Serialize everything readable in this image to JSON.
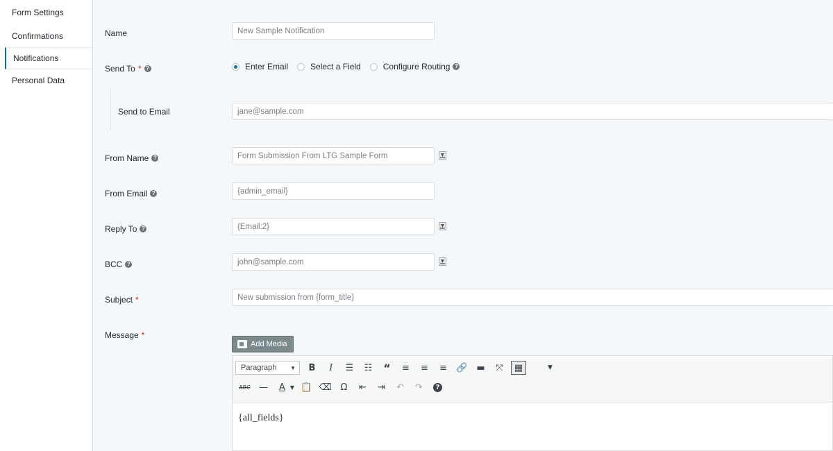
{
  "sidebar": {
    "items": [
      {
        "label": "Form Settings"
      },
      {
        "label": "Confirmations"
      },
      {
        "label": "Notifications"
      },
      {
        "label": "Personal Data"
      }
    ]
  },
  "form": {
    "name": {
      "label": "Name",
      "value": "New Sample Notification"
    },
    "send_to": {
      "label": "Send To",
      "required_mark": "*",
      "options": [
        "Enter Email",
        "Select a Field",
        "Configure Routing"
      ],
      "selected": "Enter Email"
    },
    "send_to_email": {
      "label": "Send to Email",
      "value": "jane@sample.com"
    },
    "from_name": {
      "label": "From Name",
      "value": "Form Submission From LTG Sample Form"
    },
    "from_email": {
      "label": "From Email",
      "value": "{admin_email}"
    },
    "reply_to": {
      "label": "Reply To",
      "value": "{Email:2}"
    },
    "bcc": {
      "label": "BCC",
      "value": "john@sample.com"
    },
    "subject": {
      "label": "Subject",
      "required_mark": "*",
      "value": "New submission from {form_title}"
    },
    "message": {
      "label": "Message",
      "required_mark": "*"
    }
  },
  "editor": {
    "add_media_label": "Add Media",
    "format_select": "Paragraph",
    "content": "{all_fields}",
    "toolbar_row1_icons": [
      "bold-icon",
      "italic-icon",
      "bullet-list-icon",
      "numbered-list-icon",
      "blockquote-icon",
      "align-left-icon",
      "align-center-icon",
      "align-right-icon",
      "link-icon",
      "read-more-icon",
      "fullscreen-icon",
      "toolbar-toggle-icon"
    ],
    "toolbar_row2_icons": [
      "strikethrough-icon",
      "horizontal-line-icon",
      "text-color-icon",
      "paste-as-text-icon",
      "clear-formatting-icon",
      "special-character-icon",
      "outdent-icon",
      "indent-icon",
      "undo-icon",
      "redo-icon",
      "help-icon"
    ]
  },
  "colors": {
    "accent": "#0073aa",
    "required": "#c02b0a",
    "add_media_bg": "#7c8a8e"
  }
}
